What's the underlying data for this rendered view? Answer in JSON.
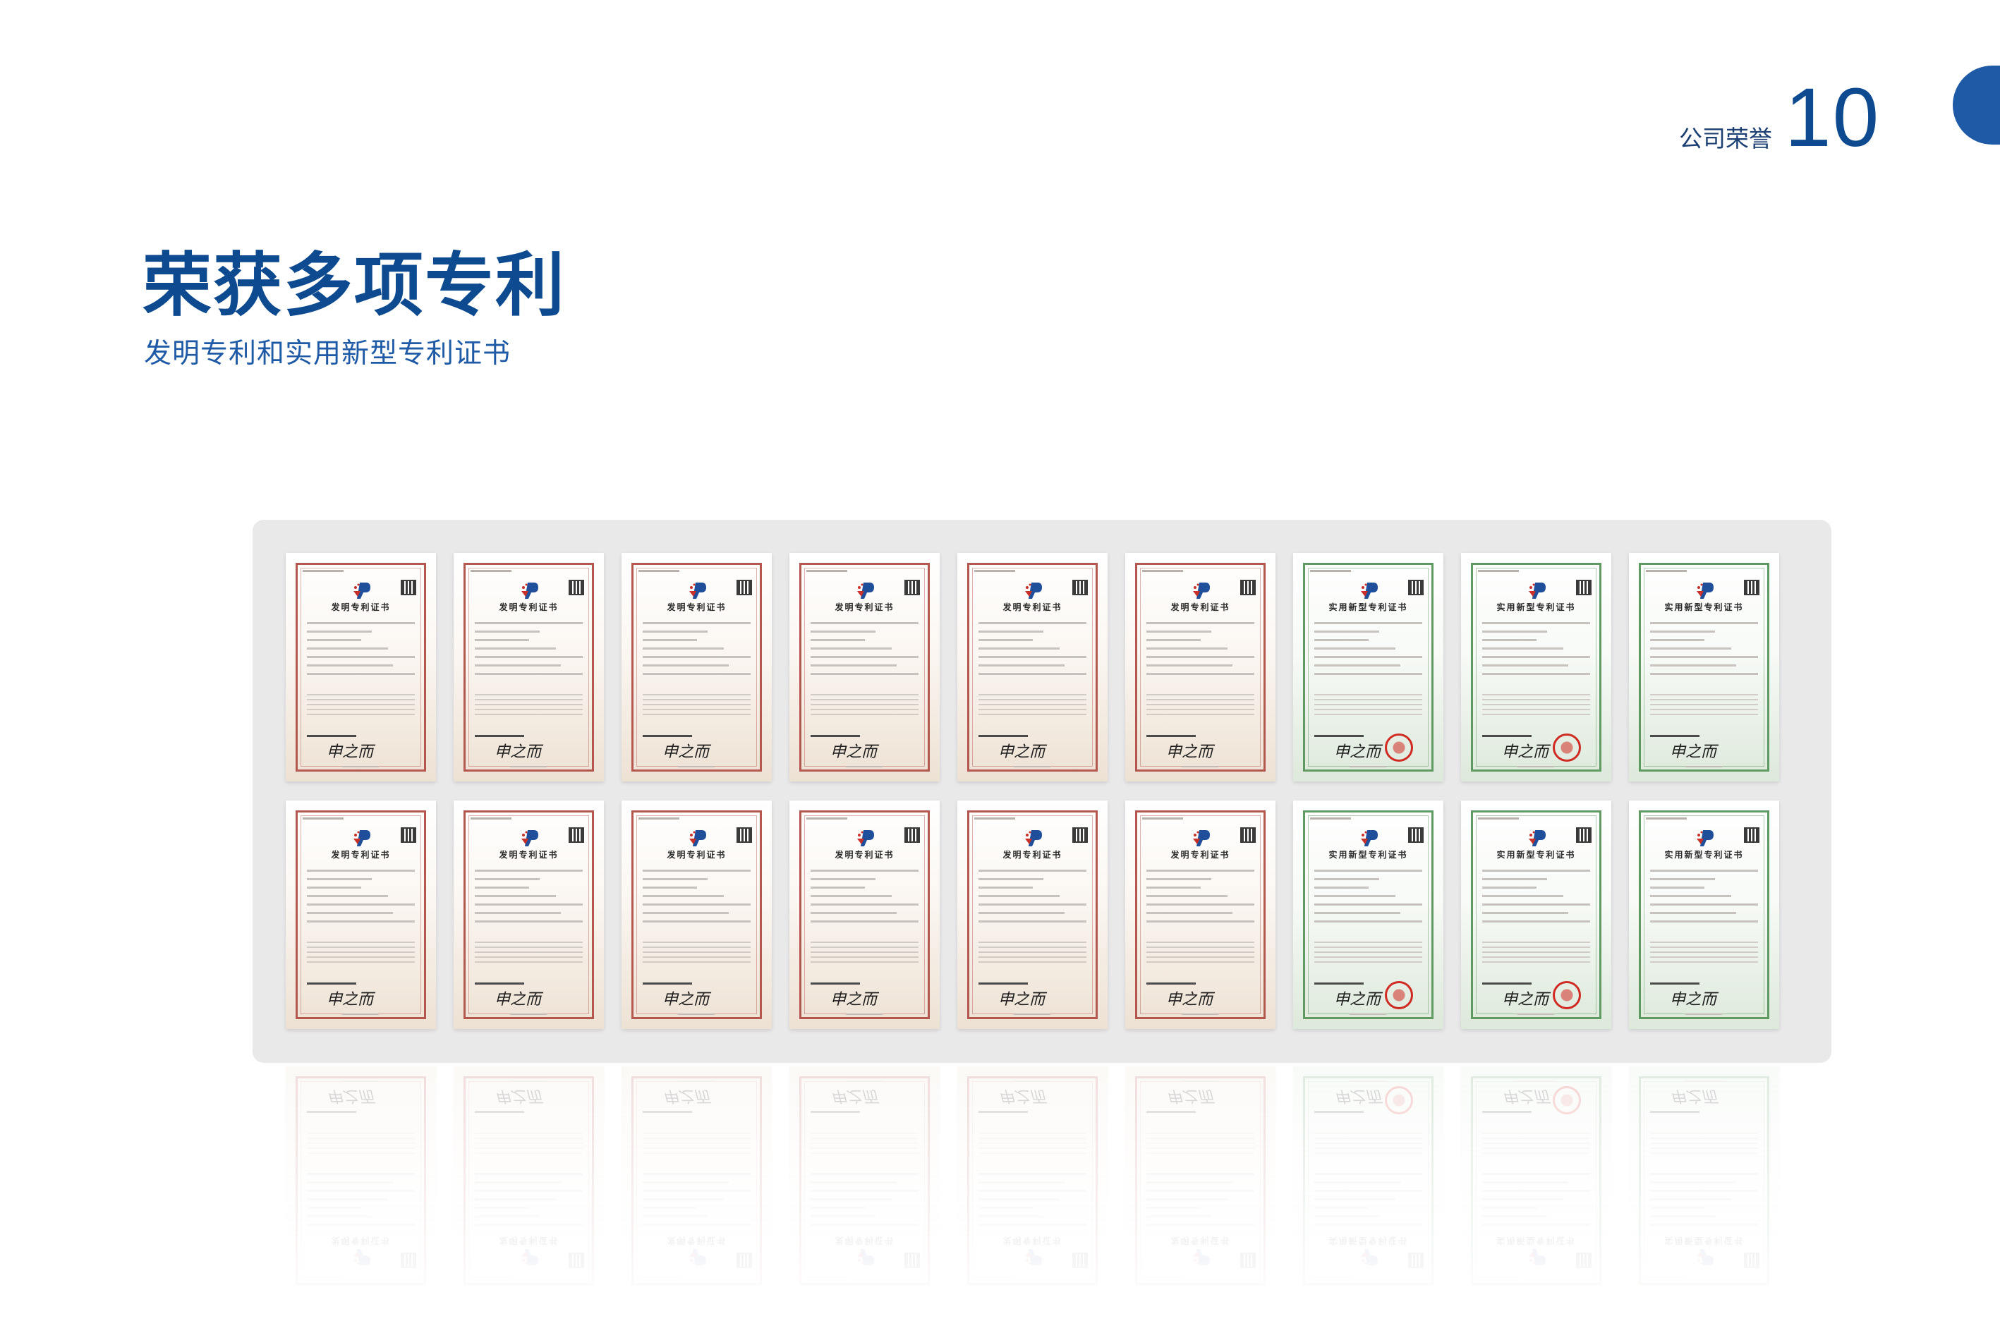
{
  "header": {
    "section_label": "公司荣誉",
    "page_number": "10"
  },
  "title": "荣获多项专利",
  "subtitle": "发明专利和实用新型专利证书",
  "certificates": [
    {
      "type": "invention",
      "name": "发明专利证书"
    },
    {
      "type": "invention",
      "name": "发明专利证书"
    },
    {
      "type": "invention",
      "name": "发明专利证书"
    },
    {
      "type": "invention",
      "name": "发明专利证书"
    },
    {
      "type": "invention",
      "name": "发明专利证书"
    },
    {
      "type": "invention",
      "name": "发明专利证书"
    },
    {
      "type": "utility",
      "name": "实用新型专利证书"
    },
    {
      "type": "utility",
      "name": "实用新型专利证书"
    },
    {
      "type": "utility",
      "name": "实用新型专利证书"
    },
    {
      "type": "invention",
      "name": "发明专利证书"
    },
    {
      "type": "invention",
      "name": "发明专利证书"
    },
    {
      "type": "invention",
      "name": "发明专利证书"
    },
    {
      "type": "invention",
      "name": "发明专利证书"
    },
    {
      "type": "invention",
      "name": "发明专利证书"
    },
    {
      "type": "invention",
      "name": "发明专利证书"
    },
    {
      "type": "utility",
      "name": "实用新型专利证书"
    },
    {
      "type": "utility",
      "name": "实用新型专利证书"
    },
    {
      "type": "utility",
      "name": "实用新型专利证书"
    }
  ],
  "colors": {
    "brand_blue": "#0d4a8f",
    "invention_border": "#b3574f",
    "utility_border": "#5f9a62",
    "seal_red": "#cf2b22"
  }
}
